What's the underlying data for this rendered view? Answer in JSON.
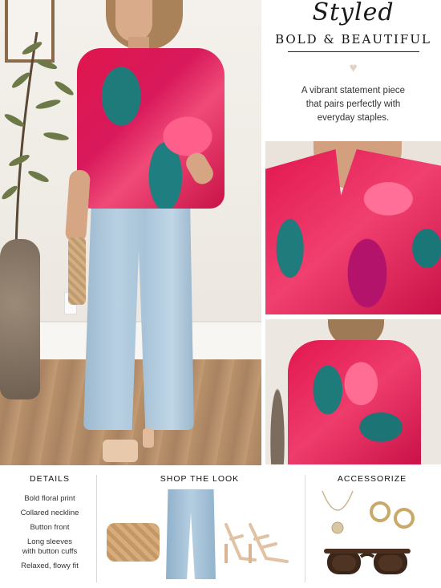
{
  "header": {
    "script_title": "Styled",
    "main_title": "BOLD & BEAUTIFUL",
    "heart_icon": "heart-icon",
    "tagline": "A vibrant statement piece that pairs perfectly with everyday staples."
  },
  "details": {
    "heading": "DETAILS",
    "items": [
      "Bold floral print",
      "Collared neckline",
      "Button front",
      "Long sleeves with button cuffs",
      "Relaxed, flowy fit"
    ]
  },
  "shop": {
    "heading": "SHOP THE LOOK",
    "products": [
      "woven-clutch",
      "wide-leg-jeans",
      "strappy-heels"
    ]
  },
  "accessorize": {
    "heading": "ACCESSORIZE",
    "products": [
      "pendant-necklace",
      "hoop-earrings",
      "tortoiseshell-sunglasses"
    ]
  },
  "colors": {
    "accent_pink": "#e0164d",
    "accent_teal": "#1e7b7a",
    "heart": "#e3d2c4"
  }
}
